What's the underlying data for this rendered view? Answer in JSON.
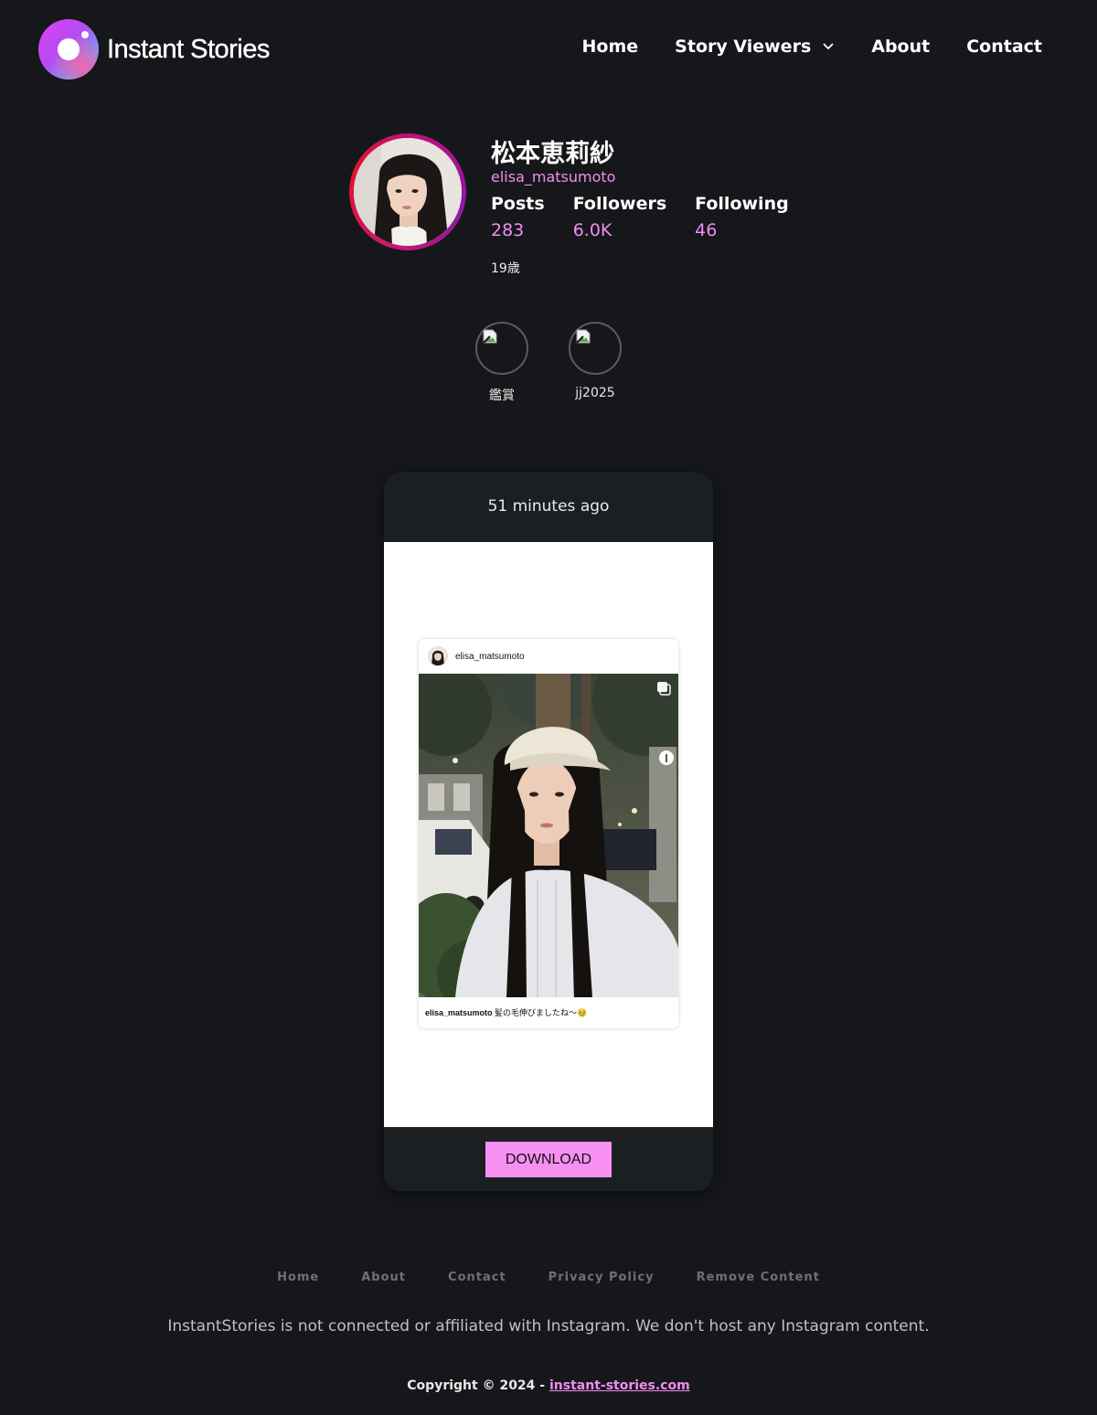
{
  "header": {
    "brand": "Instant Stories",
    "nav": {
      "home": "Home",
      "story_viewers": "Story Viewers",
      "about": "About",
      "contact": "Contact"
    }
  },
  "profile": {
    "name": "松本恵莉紗",
    "handle": "elisa_matsumoto",
    "stats": {
      "posts_label": "Posts",
      "posts_value": "283",
      "followers_label": "Followers",
      "followers_value": "6.0K",
      "following_label": "Following",
      "following_value": "46"
    },
    "bio": "19歳"
  },
  "highlights": [
    {
      "label": "鑑賞"
    },
    {
      "label": "jj2025"
    }
  ],
  "story": {
    "time": "51 minutes ago",
    "embed": {
      "username": "elisa_matsumoto",
      "caption_user": "elisa_matsumoto",
      "caption_text": "髪の毛伸びましたね〜🥹"
    },
    "download_label": "DOWNLOAD"
  },
  "footer": {
    "links": {
      "home": "Home",
      "about": "About",
      "contact": "Contact",
      "privacy": "Privacy Policy",
      "remove": "Remove Content"
    },
    "disclaimer": "InstantStories is not connected or affiliated with Instagram. We don't host any Instagram content.",
    "copyright_prefix": "Copyright © 2024 - ",
    "copyright_link": "instant-stories.com"
  },
  "colors": {
    "background": "#15171a",
    "accent": "#f28cf0",
    "button": "#f78ff3",
    "card": "#1c1f22"
  }
}
